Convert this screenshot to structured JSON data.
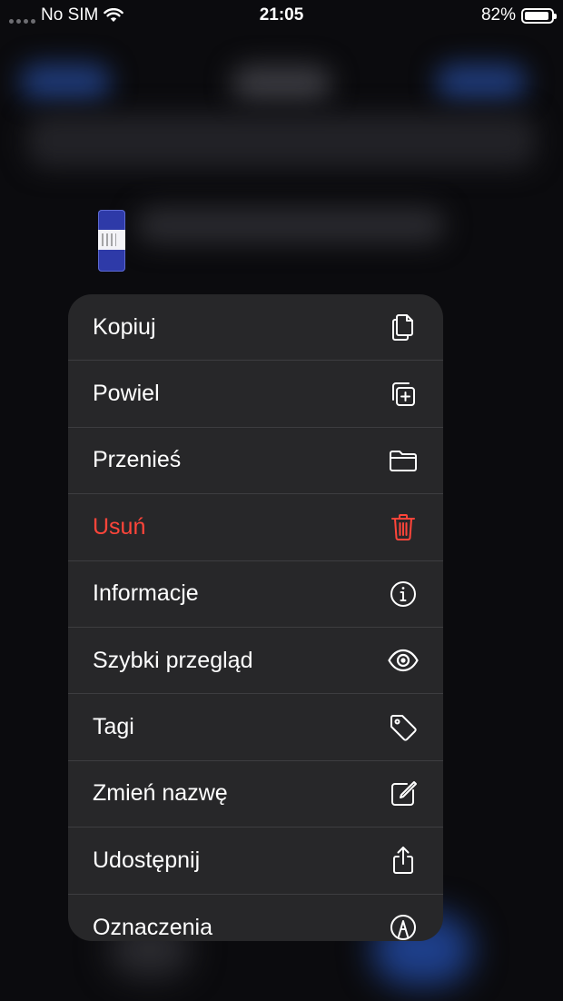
{
  "status_bar": {
    "carrier": "No SIM",
    "time": "21:05",
    "battery_percent": "82%",
    "battery_level": 0.82
  },
  "context_menu": {
    "items": [
      {
        "label": "Kopiuj",
        "icon": "copy-icon"
      },
      {
        "label": "Powiel",
        "icon": "duplicate-icon"
      },
      {
        "label": "Przenieś",
        "icon": "folder-icon"
      },
      {
        "label": "Usuń",
        "icon": "trash-icon",
        "destructive": true
      },
      {
        "label": "Informacje",
        "icon": "info-icon"
      },
      {
        "label": "Szybki przegląd",
        "icon": "eye-icon"
      },
      {
        "label": "Tagi",
        "icon": "tag-icon"
      },
      {
        "label": "Zmień nazwę",
        "icon": "rename-icon"
      },
      {
        "label": "Udostępnij",
        "icon": "share-icon"
      },
      {
        "label": "Oznaczenia",
        "icon": "markup-icon"
      }
    ]
  },
  "colors": {
    "destructive": "#ff453a",
    "menu_background": "#272729",
    "text": "#ffffff"
  }
}
